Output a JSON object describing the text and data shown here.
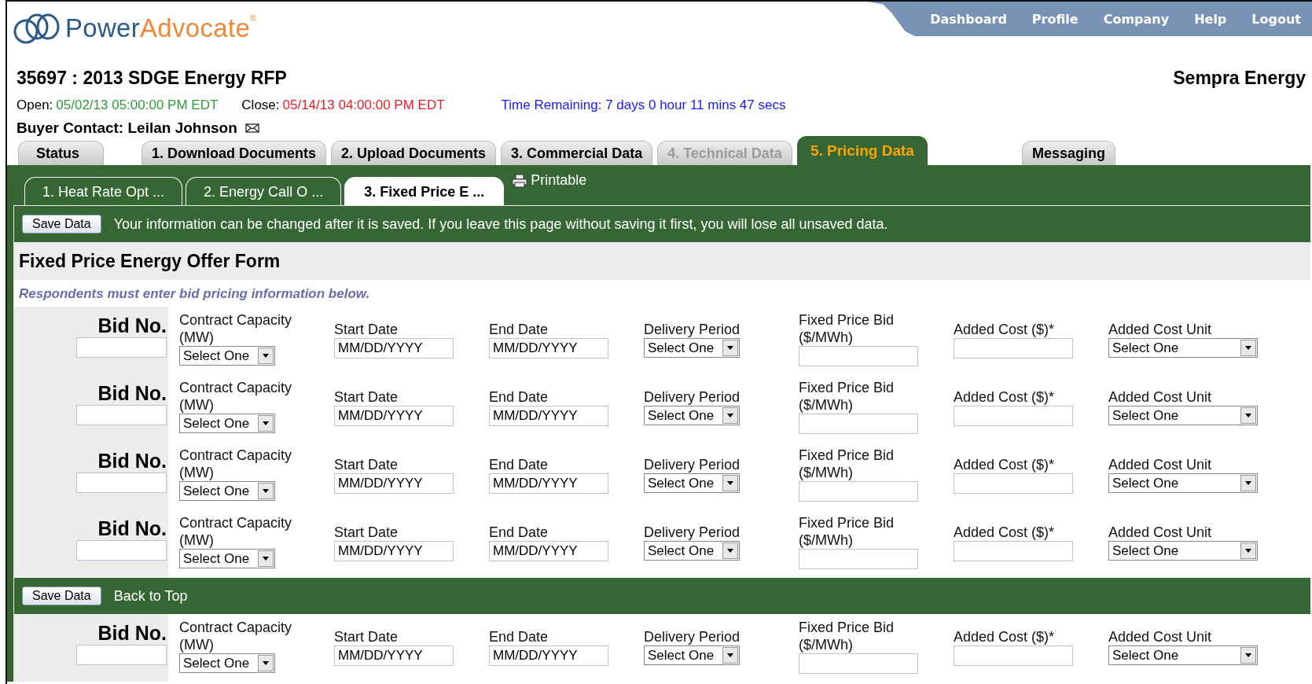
{
  "logo": {
    "name_a": "Power",
    "name_b": "Advocate",
    "mark": "®"
  },
  "nav": [
    "Dashboard",
    "Profile",
    "Company",
    "Help",
    "Logout"
  ],
  "event": {
    "title": "35697 : 2013 SDGE Energy RFP",
    "company": "Sempra Energy",
    "open_label": "Open:",
    "open_value": "05/02/13 05:00:00 PM EDT",
    "close_label": "Close:",
    "close_value": "05/14/13 04:00:00 PM EDT",
    "time_remaining": "Time Remaining: 7 days 0 hour 11 mins 47 secs",
    "buyer_contact": "Buyer Contact: Leilan Johnson"
  },
  "tabs": [
    {
      "label": "Status",
      "selected": false,
      "disabled": false
    },
    {
      "label": "1. Download Documents",
      "selected": false,
      "disabled": false
    },
    {
      "label": "2. Upload Documents",
      "selected": false,
      "disabled": false
    },
    {
      "label": "3. Commercial Data",
      "selected": false,
      "disabled": false
    },
    {
      "label": "4. Technical Data",
      "selected": false,
      "disabled": true
    },
    {
      "label": "5. Pricing Data",
      "selected": true,
      "disabled": false
    },
    {
      "label": "Messaging",
      "selected": false,
      "disabled": false
    }
  ],
  "subtabs": [
    {
      "label": "1. Heat Rate Opt ...",
      "selected": false
    },
    {
      "label": "2. Energy Call O ...",
      "selected": false
    },
    {
      "label": "3. Fixed Price E ...",
      "selected": true
    }
  ],
  "printable": "Printable",
  "save_bar": {
    "button": "Save Data",
    "message": "Your information can be changed after it is saved. If you leave this page without saving it first, you will lose all unsaved data."
  },
  "form": {
    "title": "Fixed Price Energy Offer Form",
    "instruction": "Respondents must enter bid pricing information below."
  },
  "rows_top": [
    {
      "bid_label": "Bid No.",
      "cells": [
        {
          "kind": "select",
          "label": "Contract Capacity (MW)",
          "value": "Select One"
        },
        {
          "kind": "date",
          "label": "Start Date",
          "placeholder": "MM/DD/YYYY"
        },
        {
          "kind": "date",
          "label": "End Date",
          "placeholder": "MM/DD/YYYY"
        },
        {
          "kind": "select",
          "label": "Delivery Period",
          "value": "Select One"
        },
        {
          "kind": "text",
          "label": "Fixed Price Bid ($/MWh)"
        },
        {
          "kind": "text",
          "label": "Added Cost ($)*"
        },
        {
          "kind": "wide-select",
          "label": "Added Cost Unit",
          "value": "Select One"
        }
      ]
    },
    {
      "bid_label": "Bid No.",
      "cells": [
        {
          "kind": "select",
          "label": "Contract Capacity (MW)",
          "value": "Select One"
        },
        {
          "kind": "date",
          "label": "Start Date",
          "placeholder": "MM/DD/YYYY"
        },
        {
          "kind": "date",
          "label": "End Date",
          "placeholder": "MM/DD/YYYY"
        },
        {
          "kind": "select",
          "label": "Delivery Period",
          "value": "Select One"
        },
        {
          "kind": "text",
          "label": "Fixed Price Bid ($/MWh)"
        },
        {
          "kind": "text",
          "label": "Added Cost ($)*"
        },
        {
          "kind": "wide-select",
          "label": "Added Cost Unit",
          "value": "Select One"
        }
      ]
    },
    {
      "bid_label": "Bid No.",
      "cells": [
        {
          "kind": "select",
          "label": "Contract Capacity (MW)",
          "value": "Select One"
        },
        {
          "kind": "date",
          "label": "Start Date",
          "placeholder": "MM/DD/YYYY"
        },
        {
          "kind": "date",
          "label": "End Date",
          "placeholder": "MM/DD/YYYY"
        },
        {
          "kind": "select",
          "label": "Delivery Period",
          "value": "Select One"
        },
        {
          "kind": "text",
          "label": "Fixed Price Bid ($/MWh)"
        },
        {
          "kind": "text",
          "label": "Added Cost ($)*"
        },
        {
          "kind": "wide-select",
          "label": "Added Cost Unit",
          "value": "Select One"
        }
      ]
    },
    {
      "bid_label": "Bid No.",
      "cells": [
        {
          "kind": "select",
          "label": "Contract Capacity (MW)",
          "value": "Select One"
        },
        {
          "kind": "date",
          "label": "Start Date",
          "placeholder": "MM/DD/YYYY"
        },
        {
          "kind": "date",
          "label": "End Date",
          "placeholder": "MM/DD/YYYY"
        },
        {
          "kind": "select",
          "label": "Delivery Period",
          "value": "Select One"
        },
        {
          "kind": "text",
          "label": "Fixed Price Bid ($/MWh)"
        },
        {
          "kind": "text",
          "label": "Added Cost ($)*"
        },
        {
          "kind": "wide-select",
          "label": "Added Cost Unit",
          "value": "Select One"
        }
      ]
    }
  ],
  "bottom_bar": {
    "button": "Save Data",
    "link": "Back to Top"
  },
  "rows_bottom": [
    {
      "bid_label": "Bid No.",
      "cells": [
        {
          "kind": "select",
          "label": "Contract Capacity (MW)",
          "value": "Select One"
        },
        {
          "kind": "date",
          "label": "Start Date",
          "placeholder": "MM/DD/YYYY"
        },
        {
          "kind": "date",
          "label": "End Date",
          "placeholder": "MM/DD/YYYY"
        },
        {
          "kind": "select",
          "label": "Delivery Period",
          "value": "Select One"
        },
        {
          "kind": "text",
          "label": "Fixed Price Bid ($/MWh)"
        },
        {
          "kind": "text",
          "label": "Added Cost ($)*"
        },
        {
          "kind": "wide-select",
          "label": "Added Cost Unit",
          "value": "Select One"
        }
      ]
    }
  ]
}
